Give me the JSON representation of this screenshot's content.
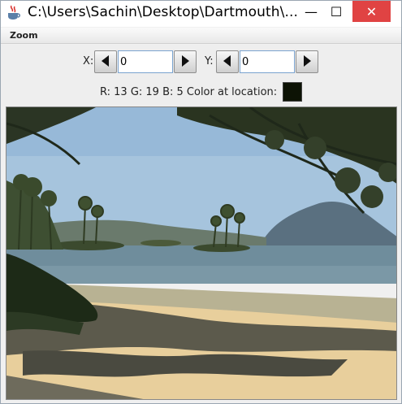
{
  "window": {
    "title": "C:\\Users\\Sachin\\Desktop\\Dartmouth\\...",
    "minimize_glyph": "—",
    "maximize_glyph": "☐",
    "close_glyph": "✕"
  },
  "menu": {
    "items": [
      "Zoom"
    ]
  },
  "controls": {
    "x_label": "X:",
    "x_value": "0",
    "y_label": "Y:",
    "y_value": "0",
    "color_info": "R: 13 G: 19 B: 5 Color at location:",
    "swatch_color": "#0d1305"
  },
  "colors": {
    "close_button": "#e04343",
    "field_border": "#7aa3cf"
  },
  "icons": {
    "app": "java-cup-icon",
    "left_arrow": "left-arrow-icon",
    "right_arrow": "right-arrow-icon"
  }
}
